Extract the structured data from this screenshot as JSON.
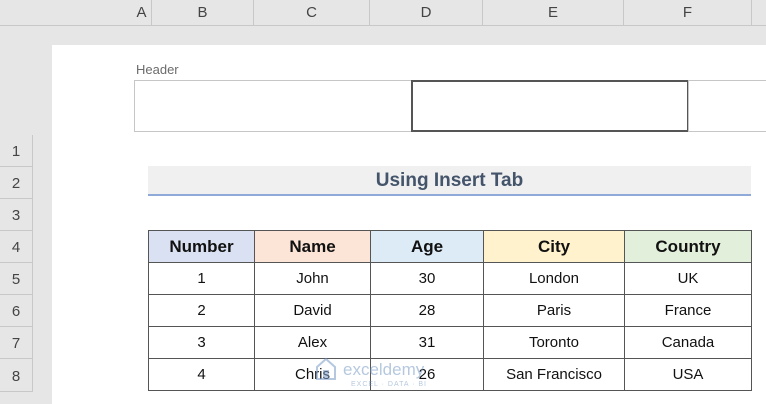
{
  "columns": [
    "A",
    "B",
    "C",
    "D",
    "E",
    "F"
  ],
  "rows": [
    "1",
    "2",
    "3",
    "4",
    "5",
    "6",
    "7",
    "8"
  ],
  "page_header": {
    "label": "Header"
  },
  "title": "Using Insert Tab",
  "table": {
    "headers": [
      "Number",
      "Name",
      "Age",
      "City",
      "Country"
    ],
    "header_colors": [
      "#d9e1f2",
      "#fce4d6",
      "#ddebf7",
      "#fff2cc",
      "#e2efda"
    ],
    "rows": [
      [
        "1",
        "John",
        "30",
        "London",
        "UK"
      ],
      [
        "2",
        "David",
        "28",
        "Paris",
        "France"
      ],
      [
        "3",
        "Alex",
        "31",
        "Toronto",
        "Canada"
      ],
      [
        "4",
        "Chris",
        "26",
        "San Francisco",
        "USA"
      ]
    ]
  },
  "watermark": {
    "brand": "exceldemy",
    "tagline": "EXCEL · DATA · BI"
  }
}
